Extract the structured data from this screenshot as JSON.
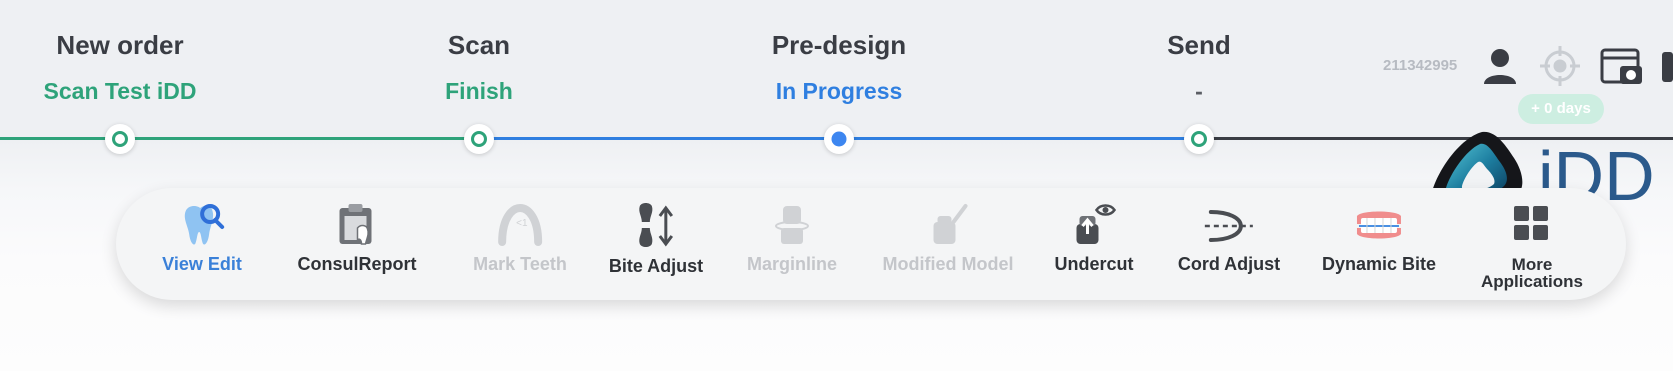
{
  "steps": [
    {
      "title": "New order",
      "status": "Scan Test iDD"
    },
    {
      "title": "Scan",
      "status": "Finish"
    },
    {
      "title": "Pre-design",
      "status": "In Progress"
    },
    {
      "title": "Send",
      "status": "-"
    }
  ],
  "header": {
    "order_id": "211342995",
    "days_badge": "+ 0 days"
  },
  "logo": {
    "text": "iDD"
  },
  "toolbar": {
    "items": [
      {
        "label": "View Edit",
        "state": "active"
      },
      {
        "label": "ConsulReport",
        "state": "enabled"
      },
      {
        "label": "Mark Teeth",
        "state": "disabled"
      },
      {
        "label": "Bite Adjust",
        "state": "enabled"
      },
      {
        "label": "Marginline",
        "state": "disabled"
      },
      {
        "label": "Modified Model",
        "state": "disabled"
      },
      {
        "label": "Undercut",
        "state": "enabled"
      },
      {
        "label": "Cord Adjust",
        "state": "enabled"
      },
      {
        "label": "Dynamic Bite",
        "state": "enabled"
      },
      {
        "label_line1": "More",
        "label_line2": "Applications",
        "state": "enabled"
      }
    ]
  },
  "colors": {
    "green": "#2ea37a",
    "blue": "#2f7fe0",
    "line_dark": "#3a3d44"
  }
}
